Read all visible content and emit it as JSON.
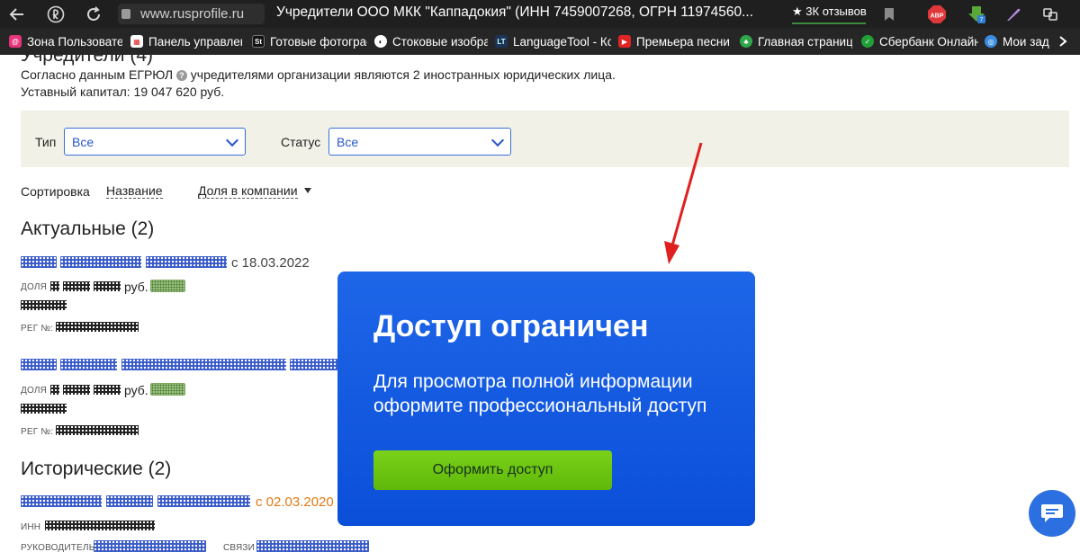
{
  "browser": {
    "url": "www.rusprofile.ru",
    "page_title": "Учредители ООО МКК \"Каппадокия\" (ИНН 7459007268, ОГРН 11974560...",
    "reviews": "3К отзывов",
    "bookmarks": [
      "Зона Пользовател",
      "Панель управлен",
      "Готовые фотограф",
      "Стоковые изобра",
      "LanguageTool - Ко",
      "Премьера песни",
      "Главная страница",
      "Сбербанк Онлайн",
      "Мои зада"
    ]
  },
  "page": {
    "section_title": "Учредители (4)",
    "info_text_before": "Согласно данным ЕГРЮЛ",
    "info_text_after": "учредителями организации являются 2 иностранных юридических лица.",
    "capital": "Уставный капитал: 19 047 620 руб.",
    "filters": {
      "type_label": "Тип",
      "type_value": "Все",
      "status_label": "Статус",
      "status_value": "Все"
    },
    "sort": {
      "label": "Сортировка",
      "by_name": "Название",
      "by_share": "Доля в компании"
    },
    "actual_heading": "Актуальные (2)",
    "historical_heading": "Исторические (2)",
    "actual_items": [
      {
        "date": "с 18.03.2022",
        "share_label": "ДОЛЯ",
        "rub": "руб.",
        "reg_label": "РЕГ №:"
      },
      {
        "share_label": "ДОЛЯ",
        "rub": "руб.",
        "reg_label": "РЕГ №:"
      }
    ],
    "historical_items": [
      {
        "date": "с 02.03.2020",
        "inn_label": "ИНН",
        "head_label": "РУКОВОДИТЕЛЬ",
        "links_label": "СВЯЗИ"
      }
    ]
  },
  "modal": {
    "title": "Доступ ограничен",
    "text": "Для просмотра полной информации оформите профессиональный доступ",
    "button": "Оформить доступ"
  },
  "colors": {
    "modal_bg": "#0b4fd9",
    "button_green": "#6cc412",
    "link_blue": "#2a56c9",
    "arrow_red": "#e01f1f"
  }
}
